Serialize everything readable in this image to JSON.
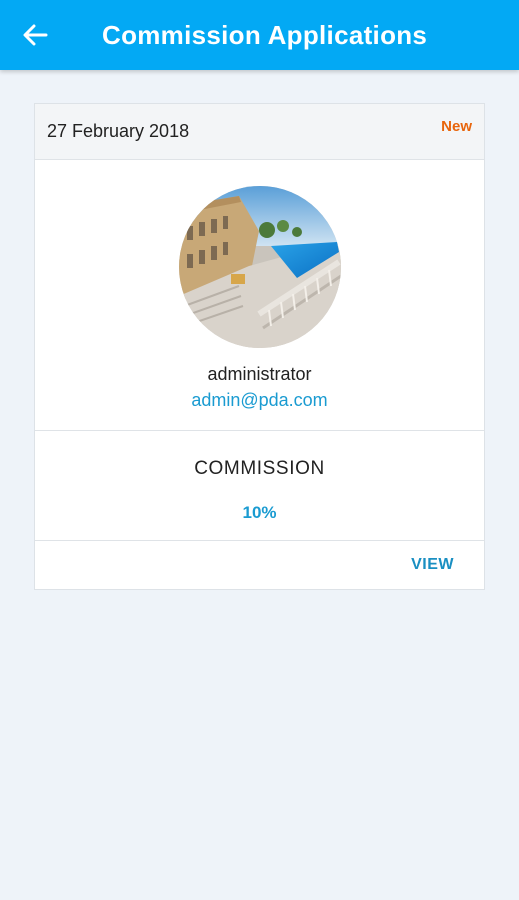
{
  "header": {
    "title": "Commission Applications",
    "back_icon": "arrow-left-icon",
    "background_color": "#03a9f4"
  },
  "card": {
    "date": "27 February 2018",
    "status": "New",
    "status_color": "#e8650c",
    "user": {
      "name": "administrator",
      "email": "admin@pda.com",
      "avatar": "avatar-photo-pool"
    },
    "commission": {
      "label": "COMMISSION",
      "value": "10%"
    },
    "actions": {
      "view_label": "VIEW"
    }
  },
  "colors": {
    "accent": "#1a9bd1",
    "page_background": "#eef3f9"
  }
}
